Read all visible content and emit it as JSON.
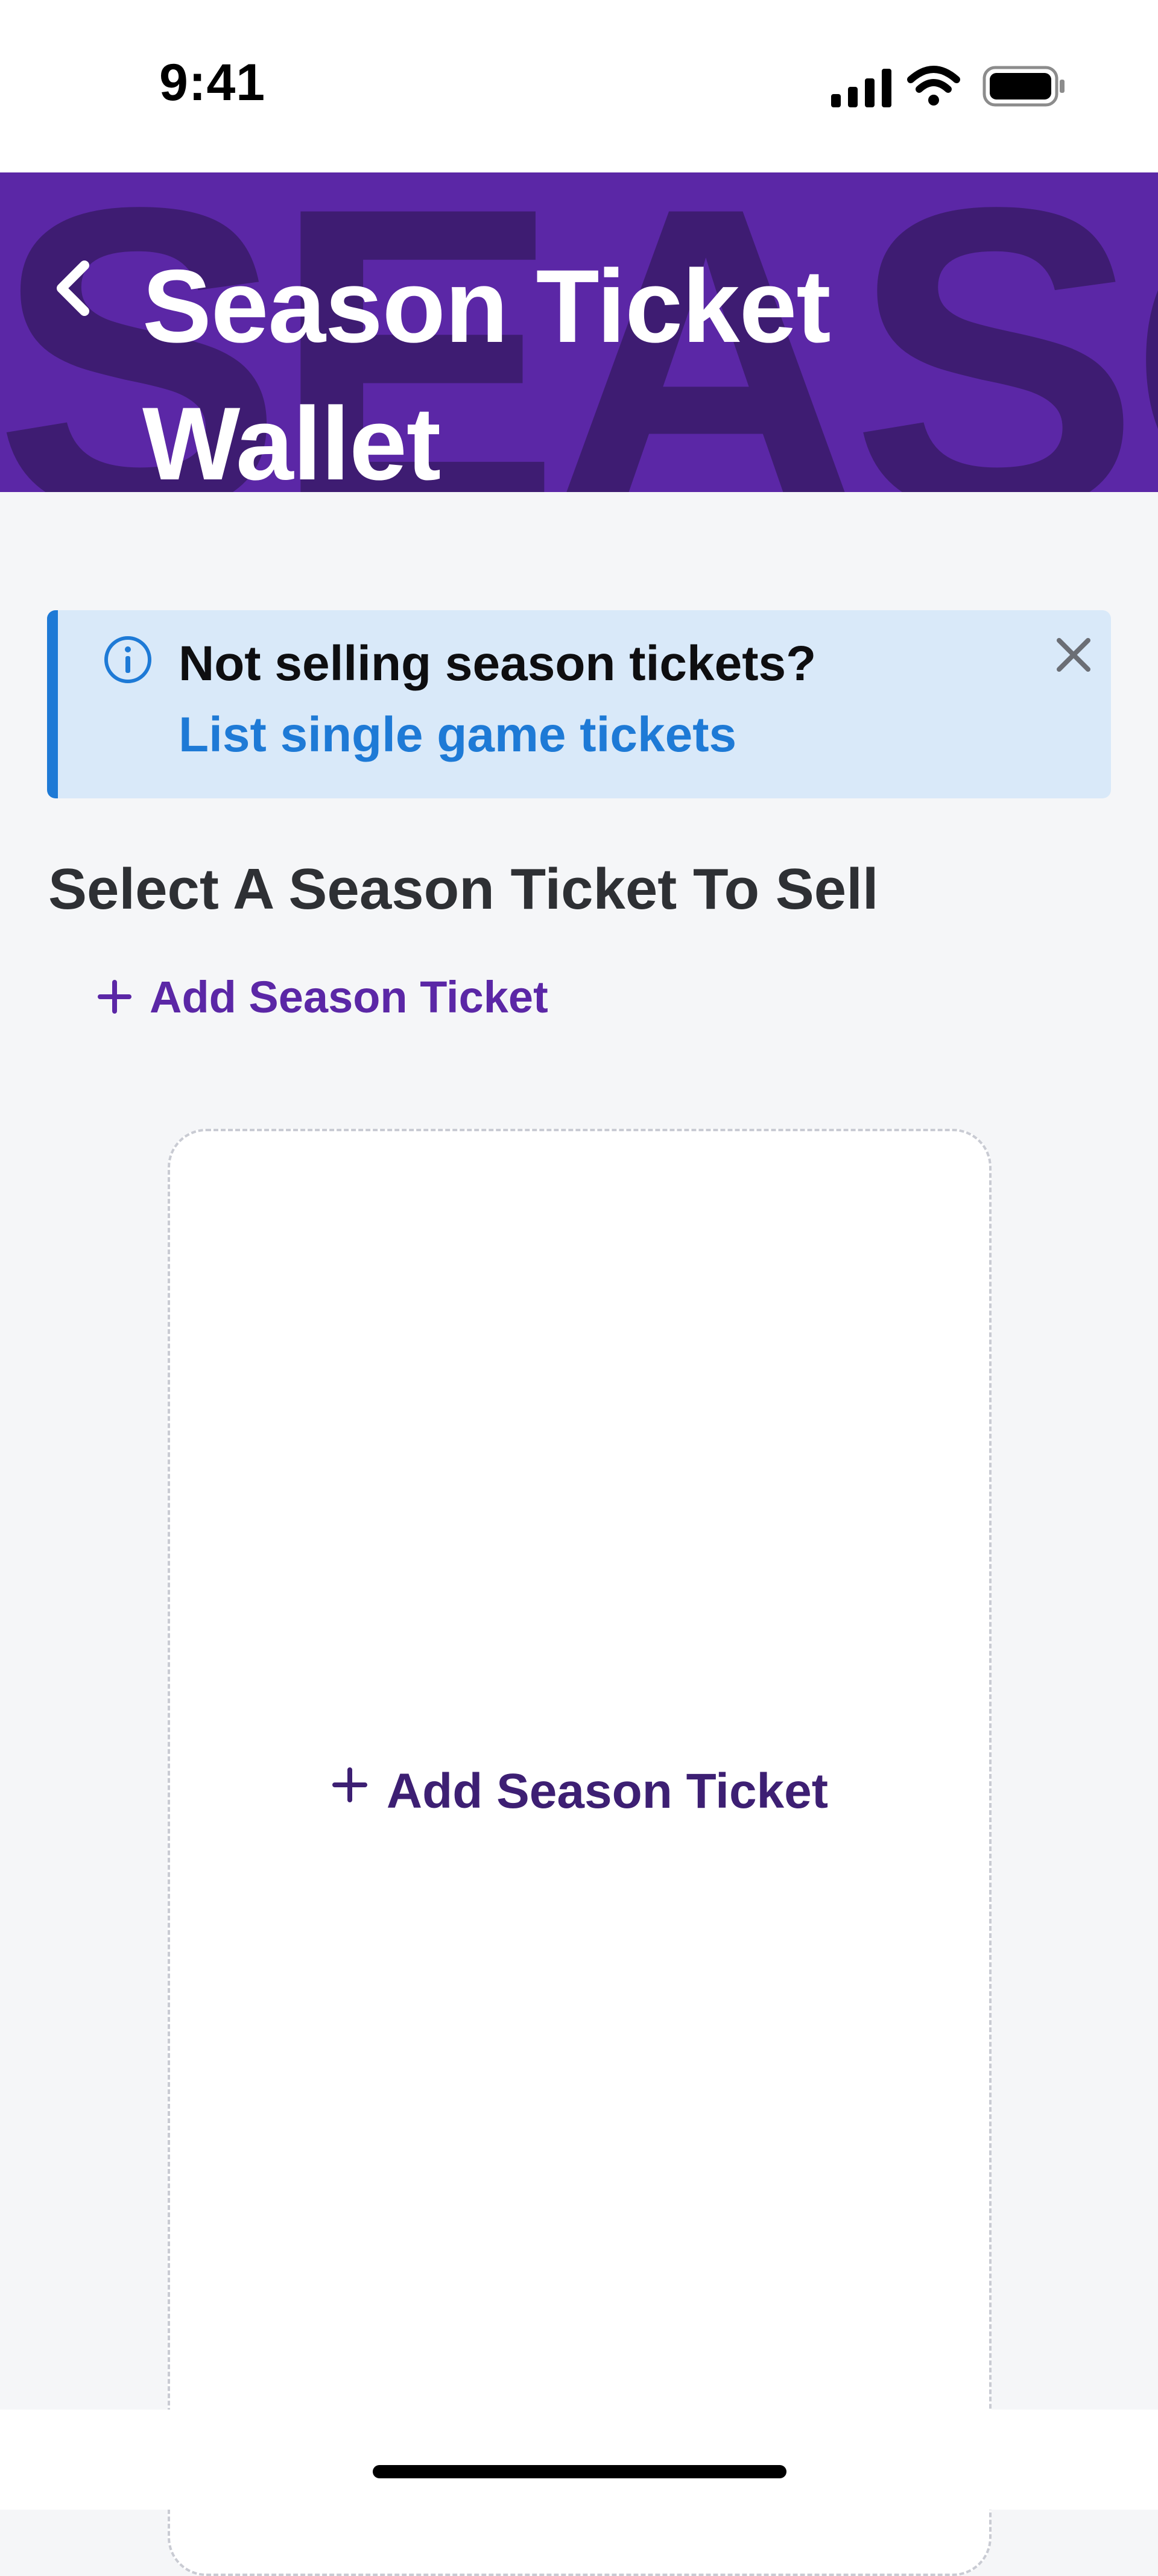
{
  "status_bar": {
    "time": "9:41",
    "icons": [
      "cellular-signal-icon",
      "wifi-icon",
      "battery-icon"
    ]
  },
  "header": {
    "title": "Season Ticket Wallet",
    "background_text": "SEASON T",
    "background_color": "#5B27A6",
    "back_icon": "chevron-left-icon"
  },
  "banner": {
    "icon": "info-icon",
    "message": "Not selling season tickets?",
    "link_label": "List single game tickets",
    "close_icon": "close-icon",
    "accent_color": "#1E7AD6"
  },
  "main": {
    "section_title": "Select A Season Ticket To Sell",
    "add_link_label": "Add Season Ticket",
    "card": {
      "add_label": "Add Season Ticket"
    }
  },
  "colors": {
    "brand_purple": "#5B27A6",
    "dark_purple": "#3D1F73",
    "info_blue": "#1E7AD6",
    "banner_bg": "#D9E9F9",
    "page_bg": "#F5F6F8"
  }
}
